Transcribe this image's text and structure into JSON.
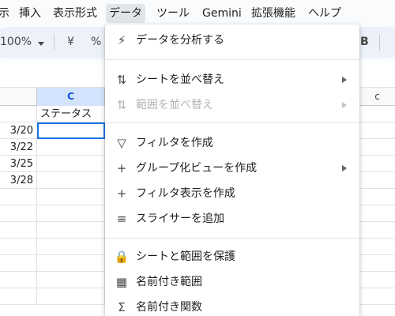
{
  "menubar": {
    "items": [
      "示",
      "挿入",
      "表示形式",
      "データ",
      "ツール",
      "Gemini",
      "拡張機能",
      "ヘルプ"
    ],
    "active": "データ"
  },
  "toolbar": {
    "zoom": "100%",
    "currency": "¥",
    "percent": "%",
    "bold": "B"
  },
  "grid": {
    "columns": [
      "C"
    ],
    "selected_column": "C",
    "right_column_hint": "c",
    "rows": [
      {
        "a": "",
        "c": "ステータス"
      },
      {
        "a": "3/20",
        "c": ""
      },
      {
        "a": "3/22",
        "c": ""
      },
      {
        "a": "3/25",
        "c": ""
      },
      {
        "a": "3/28",
        "c": ""
      },
      {
        "a": "",
        "c": ""
      },
      {
        "a": "",
        "c": ""
      },
      {
        "a": "",
        "c": ""
      },
      {
        "a": "",
        "c": ""
      },
      {
        "a": "",
        "c": ""
      },
      {
        "a": "",
        "c": ""
      },
      {
        "a": "",
        "c": ""
      }
    ]
  },
  "data_menu": {
    "items": [
      {
        "label": "データを分析する",
        "icon": "analyze-icon",
        "glyph": "⚡",
        "submenu": false,
        "disabled": false
      },
      {
        "label": "シートを並べ替え",
        "icon": "sort-icon",
        "glyph": "⇅",
        "submenu": true,
        "disabled": false
      },
      {
        "label": "範囲を並べ替え",
        "icon": "sort-range-icon",
        "glyph": "⇅",
        "submenu": true,
        "disabled": true
      },
      {
        "label": "フィルタを作成",
        "icon": "filter-icon",
        "glyph": "▽",
        "submenu": false,
        "disabled": false
      },
      {
        "label": "グループ化ビューを作成",
        "icon": "plus-icon",
        "glyph": "+",
        "submenu": true,
        "disabled": false
      },
      {
        "label": "フィルタ表示を作成",
        "icon": "plus-icon",
        "glyph": "+",
        "submenu": false,
        "disabled": false
      },
      {
        "label": "スライサーを追加",
        "icon": "slicer-icon",
        "glyph": "≡",
        "submenu": false,
        "disabled": false
      },
      {
        "label": "シートと範囲を保護",
        "icon": "lock-icon",
        "glyph": "🔒",
        "submenu": false,
        "disabled": false
      },
      {
        "label": "名前付き範囲",
        "icon": "named-range-icon",
        "glyph": "▦",
        "submenu": false,
        "disabled": false
      },
      {
        "label": "名前付き関数",
        "icon": "sigma-icon",
        "glyph": "Σ",
        "submenu": false,
        "disabled": false
      }
    ]
  }
}
